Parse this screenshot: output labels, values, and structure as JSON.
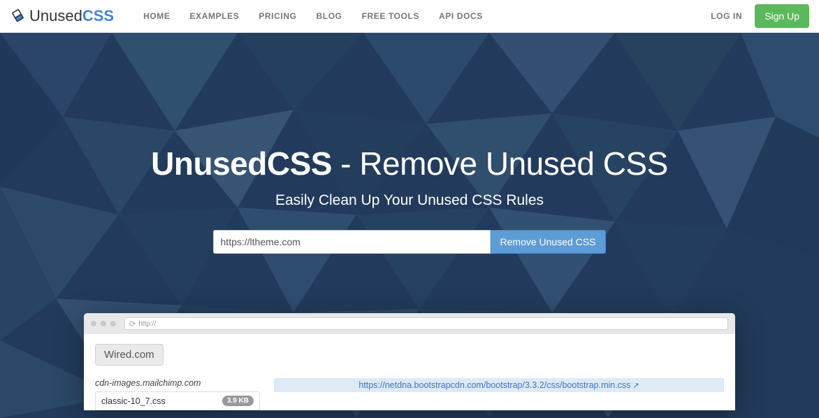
{
  "header": {
    "brand": {
      "first": "Unused",
      "second": "CSS"
    },
    "nav": [
      "HOME",
      "EXAMPLES",
      "PRICING",
      "BLOG",
      "FREE TOOLS",
      "API DOCS"
    ],
    "login": "LOG IN",
    "signup": "Sign Up"
  },
  "hero": {
    "headline_strong": "UnusedCSS",
    "headline_rest": " - Remove Unused CSS",
    "sub": "Easily Clean Up Your Unused CSS Rules",
    "url_value": "https://ltheme.com",
    "button": "Remove Unused CSS"
  },
  "mock": {
    "url_placeholder": "http://",
    "site_pill": "Wired.com",
    "left": {
      "domain": "cdn-images.mailchimp.com",
      "file": "classic-10_7.css",
      "size": "3.9 KB"
    },
    "right": {
      "link": "https://netdna.bootstrapcdn.com/bootstrap/3.3.2/css/bootstrap.min.css"
    }
  }
}
